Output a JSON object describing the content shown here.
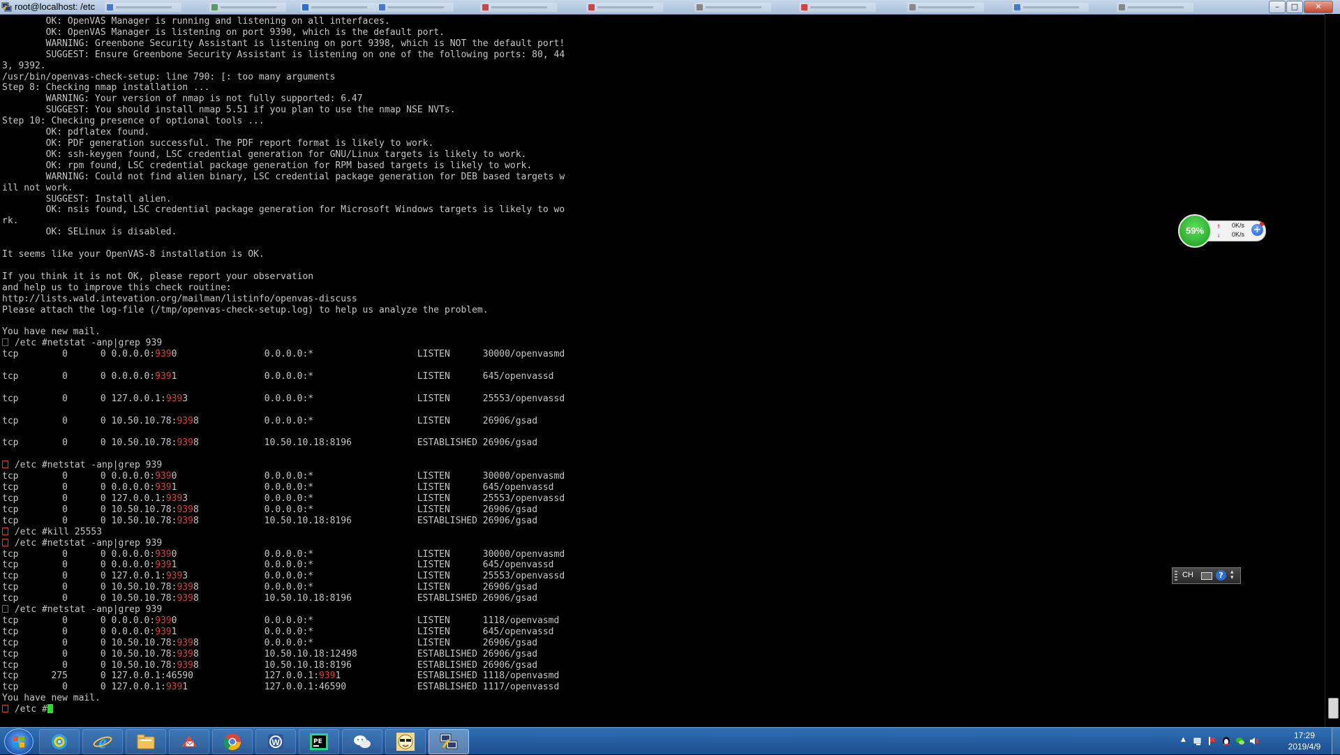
{
  "window": {
    "title": "root@localhost: /etc",
    "controls": {
      "minimize": "–",
      "maximize": "□",
      "close": "✕"
    }
  },
  "terminal": {
    "lines": [
      [
        {
          "t": "        OK: OpenVAS Manager is running and listening on all interfaces."
        }
      ],
      [
        {
          "t": "        OK: OpenVAS Manager is listening on port 9390, which is the default port."
        }
      ],
      [
        {
          "t": "        WARNING: Greenbone Security Assistant is listening on port 9398, which is NOT the default port!"
        }
      ],
      [
        {
          "t": "        SUGGEST: Ensure Greenbone Security Assistant is listening on one of the following ports: 80, 44"
        }
      ],
      [
        {
          "t": "3, 9392."
        }
      ],
      [
        {
          "t": "/usr/bin/openvas-check-setup: line 790: [: too many arguments"
        }
      ],
      [
        {
          "t": "Step 8: Checking nmap installation ..."
        }
      ],
      [
        {
          "t": "        WARNING: Your version of nmap is not fully supported: 6.47"
        }
      ],
      [
        {
          "t": "        SUGGEST: You should install nmap 5.51 if you plan to use the nmap NSE NVTs."
        }
      ],
      [
        {
          "t": "Step 10: Checking presence of optional tools ..."
        }
      ],
      [
        {
          "t": "        OK: pdflatex found."
        }
      ],
      [
        {
          "t": "        OK: PDF generation successful. The PDF report format is likely to work."
        }
      ],
      [
        {
          "t": "        OK: ssh-keygen found, LSC credential generation for GNU/Linux targets is likely to work."
        }
      ],
      [
        {
          "t": "        OK: rpm found, LSC credential package generation for RPM based targets is likely to work."
        }
      ],
      [
        {
          "t": "        WARNING: Could not find alien binary, LSC credential package generation for DEB based targets w"
        }
      ],
      [
        {
          "t": "ill not work."
        }
      ],
      [
        {
          "t": "        SUGGEST: Install alien."
        }
      ],
      [
        {
          "t": "        OK: nsis found, LSC credential package generation for Microsoft Windows targets is likely to wo"
        }
      ],
      [
        {
          "t": "rk."
        }
      ],
      [
        {
          "t": "        OK: SELinux is disabled."
        }
      ],
      [
        {
          "t": ""
        }
      ],
      [
        {
          "t": "It seems like your OpenVAS-8 installation is OK."
        }
      ],
      [
        {
          "t": ""
        }
      ],
      [
        {
          "t": "If you think it is not OK, please report your observation"
        }
      ],
      [
        {
          "t": "and help us to improve this check routine:"
        }
      ],
      [
        {
          "t": "http://lists.wald.intevation.org/mailman/listinfo/openvas-discuss"
        }
      ],
      [
        {
          "t": "Please attach the log-file (/tmp/openvas-check-setup.log) to help us analyze the problem."
        }
      ],
      [
        {
          "t": ""
        }
      ],
      [
        {
          "t": "You have new mail."
        }
      ],
      [
        {
          "p": 1
        },
        {
          "t": " /etc #netstat -anp|grep 939"
        }
      ],
      [
        {
          "t": "tcp        0      0 0.0.0.0:"
        },
        {
          "h": "939"
        },
        {
          "t": "0                0.0.0.0:*                   LISTEN      30000/openvasmd"
        }
      ],
      [
        {
          "t": ""
        }
      ],
      [
        {
          "t": "tcp        0      0 0.0.0.0:"
        },
        {
          "h": "939"
        },
        {
          "t": "1                0.0.0.0:*                   LISTEN      645/openvassd"
        }
      ],
      [
        {
          "t": ""
        }
      ],
      [
        {
          "t": "tcp        0      0 127.0.0.1:"
        },
        {
          "h": "939"
        },
        {
          "t": "3              0.0.0.0:*                   LISTEN      25553/openvassd"
        }
      ],
      [
        {
          "t": ""
        }
      ],
      [
        {
          "t": "tcp        0      0 10.50.10.78:"
        },
        {
          "h": "939"
        },
        {
          "t": "8            0.0.0.0:*                   LISTEN      26906/gsad"
        }
      ],
      [
        {
          "t": ""
        }
      ],
      [
        {
          "t": "tcp        0      0 10.50.10.78:"
        },
        {
          "h": "939"
        },
        {
          "t": "8            10.50.10.18:8196            ESTABLISHED 26906/gsad"
        }
      ],
      [
        {
          "t": ""
        }
      ],
      [
        {
          "p": 1
        },
        {
          "t": " /etc #netstat -anp|grep 939"
        }
      ],
      [
        {
          "t": "tcp        0      0 0.0.0.0:"
        },
        {
          "h": "939"
        },
        {
          "t": "0                0.0.0.0:*                   LISTEN      30000/openvasmd"
        }
      ],
      [
        {
          "t": "tcp        0      0 0.0.0.0:"
        },
        {
          "h": "939"
        },
        {
          "t": "1                0.0.0.0:*                   LISTEN      645/openvassd"
        }
      ],
      [
        {
          "t": "tcp        0      0 127.0.0.1:"
        },
        {
          "h": "939"
        },
        {
          "t": "3              0.0.0.0:*                   LISTEN      25553/openvassd"
        }
      ],
      [
        {
          "t": "tcp        0      0 10.50.10.78:"
        },
        {
          "h": "939"
        },
        {
          "t": "8            0.0.0.0:*                   LISTEN      26906/gsad"
        }
      ],
      [
        {
          "t": "tcp        0      0 10.50.10.78:"
        },
        {
          "h": "939"
        },
        {
          "t": "8            10.50.10.18:8196            ESTABLISHED 26906/gsad"
        }
      ],
      [
        {
          "p": 1
        },
        {
          "t": " /etc #kill 25553"
        }
      ],
      [
        {
          "p": 1
        },
        {
          "t": " /etc #netstat -anp|grep 939"
        }
      ],
      [
        {
          "t": "tcp        0      0 0.0.0.0:"
        },
        {
          "h": "939"
        },
        {
          "t": "0                0.0.0.0:*                   LISTEN      30000/openvasmd"
        }
      ],
      [
        {
          "t": "tcp        0      0 0.0.0.0:"
        },
        {
          "h": "939"
        },
        {
          "t": "1                0.0.0.0:*                   LISTEN      645/openvassd"
        }
      ],
      [
        {
          "t": "tcp        0      0 127.0.0.1:"
        },
        {
          "h": "939"
        },
        {
          "t": "3              0.0.0.0:*                   LISTEN      25553/openvassd"
        }
      ],
      [
        {
          "t": "tcp        0      0 10.50.10.78:"
        },
        {
          "h": "939"
        },
        {
          "t": "8            0.0.0.0:*                   LISTEN      26906/gsad"
        }
      ],
      [
        {
          "t": "tcp        0      0 10.50.10.78:"
        },
        {
          "h": "939"
        },
        {
          "t": "8            10.50.10.18:8196            ESTABLISHED 26906/gsad"
        }
      ],
      [
        {
          "p": 1
        },
        {
          "t": " /etc #netstat -anp|grep 939"
        }
      ],
      [
        {
          "t": "tcp        0      0 0.0.0.0:"
        },
        {
          "h": "939"
        },
        {
          "t": "0                0.0.0.0:*                   LISTEN      1118/openvasmd"
        }
      ],
      [
        {
          "t": "tcp        0      0 0.0.0.0:"
        },
        {
          "h": "939"
        },
        {
          "t": "1                0.0.0.0:*                   LISTEN      645/openvassd"
        }
      ],
      [
        {
          "t": "tcp        0      0 10.50.10.78:"
        },
        {
          "h": "939"
        },
        {
          "t": "8            0.0.0.0:*                   LISTEN      26906/gsad"
        }
      ],
      [
        {
          "t": "tcp        0      0 10.50.10.78:"
        },
        {
          "h": "939"
        },
        {
          "t": "8            10.50.10.18:12498           ESTABLISHED 26906/gsad"
        }
      ],
      [
        {
          "t": "tcp        0      0 10.50.10.78:"
        },
        {
          "h": "939"
        },
        {
          "t": "8            10.50.10.18:8196            ESTABLISHED 26906/gsad"
        }
      ],
      [
        {
          "t": "tcp      275      0 127.0.0.1:46590             127.0.0.1:"
        },
        {
          "h": "939"
        },
        {
          "t": "1              ESTABLISHED 1118/openvasmd"
        }
      ],
      [
        {
          "t": "tcp        0      0 127.0.0.1:"
        },
        {
          "h": "939"
        },
        {
          "t": "1              127.0.0.1:46590             ESTABLISHED 1117/openvassd"
        }
      ],
      [
        {
          "t": "You have new mail."
        }
      ],
      [
        {
          "p": 1
        },
        {
          "t": " /etc #"
        },
        {
          "c": 1
        }
      ]
    ]
  },
  "net_widget": {
    "cpu_percent": "59%",
    "upload_rate": "0K/s",
    "download_rate": "0K/s",
    "add_label": "+"
  },
  "ime_bar": {
    "language": "CH",
    "help_label": "?"
  },
  "taskbar": {
    "items": [
      {
        "name": "taskbar-360-security",
        "icon": "shield-360-icon"
      },
      {
        "name": "taskbar-internet-explorer",
        "icon": "ie-icon"
      },
      {
        "name": "taskbar-file-explorer",
        "icon": "folder-icon"
      },
      {
        "name": "taskbar-foxmail",
        "icon": "foxmail-icon"
      },
      {
        "name": "taskbar-chrome",
        "icon": "chrome-icon"
      },
      {
        "name": "taskbar-word",
        "icon": "word-icon"
      },
      {
        "name": "taskbar-pycharm",
        "icon": "pycharm-icon"
      },
      {
        "name": "taskbar-wechat",
        "icon": "wechat-icon"
      },
      {
        "name": "taskbar-qq-avatar",
        "icon": "avatar-icon"
      },
      {
        "name": "taskbar-putty",
        "icon": "putty-icon",
        "active": true
      }
    ],
    "clock_time": "17:29",
    "clock_date": "2019/4/9",
    "tray_up_label": "▲"
  },
  "colors": {
    "terminal_bg": "#000000",
    "terminal_fg": "#c6c6c6",
    "highlight": "#e23a3a",
    "cursor": "#28e028",
    "taskbar": "#1b4e8f"
  }
}
